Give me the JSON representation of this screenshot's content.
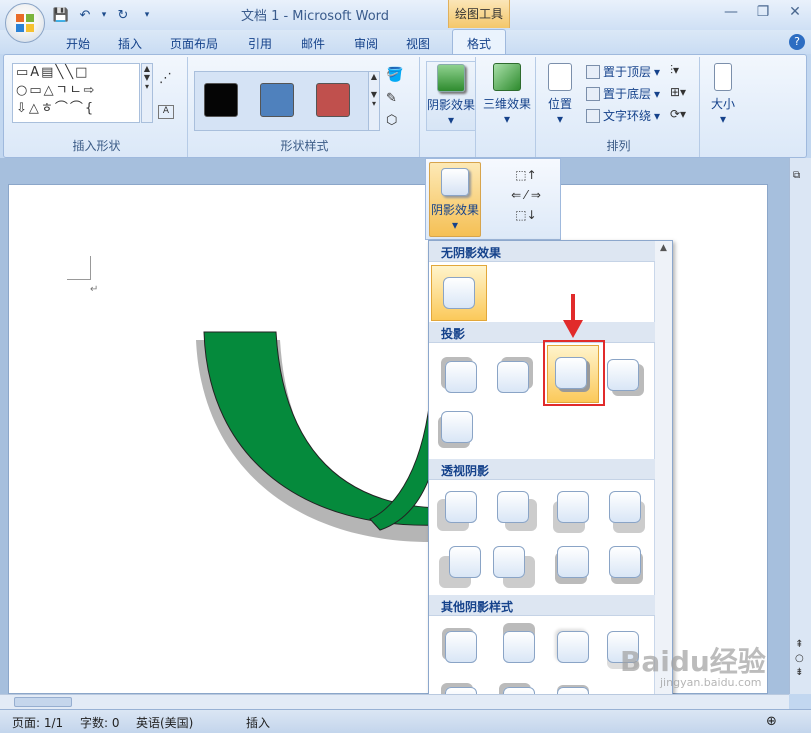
{
  "title_bar": {
    "document_title": "文档 1 - Microsoft Word",
    "context_tab_title": "绘图工具"
  },
  "quick_access": [
    "save-icon",
    "undo-icon",
    "redo-icon",
    "customize-icon"
  ],
  "tabs": [
    "开始",
    "插入",
    "页面布局",
    "引用",
    "邮件",
    "审阅",
    "视图",
    "格式"
  ],
  "active_tab": "格式",
  "ribbon": {
    "insert_shapes_label": "插入形状",
    "shape_styles_label": "形状样式",
    "shadow_effects_label": "阴影效果",
    "threed_effects_label": "三维效果",
    "position_label": "位置",
    "bring_front_label": "置于顶层",
    "send_back_label": "置于底层",
    "text_wrap_label": "文字环绕",
    "arrange_label": "排列",
    "size_label": "大小",
    "style_swatches": [
      "#050505",
      "#4f81bd",
      "#c0504d"
    ]
  },
  "float_panel": {
    "shadow_effects_label": "阴影效果"
  },
  "dropdown": {
    "no_shadow_header": "无阴影效果",
    "drop_shadow_header": "投影",
    "perspective_header": "透视阴影",
    "other_header": "其他阴影样式"
  },
  "statusbar": {
    "page": "页面: 1/1",
    "words": "字数: 0",
    "language": "英语(美国)",
    "insert_mode": "插入"
  },
  "watermark": {
    "text": "Baidu经验",
    "sub": "jingyan.baidu.com"
  },
  "colors": {
    "shape_fill": "#058a3c",
    "highlight": "#e12b2b",
    "selected_option": "#fbc95a"
  }
}
